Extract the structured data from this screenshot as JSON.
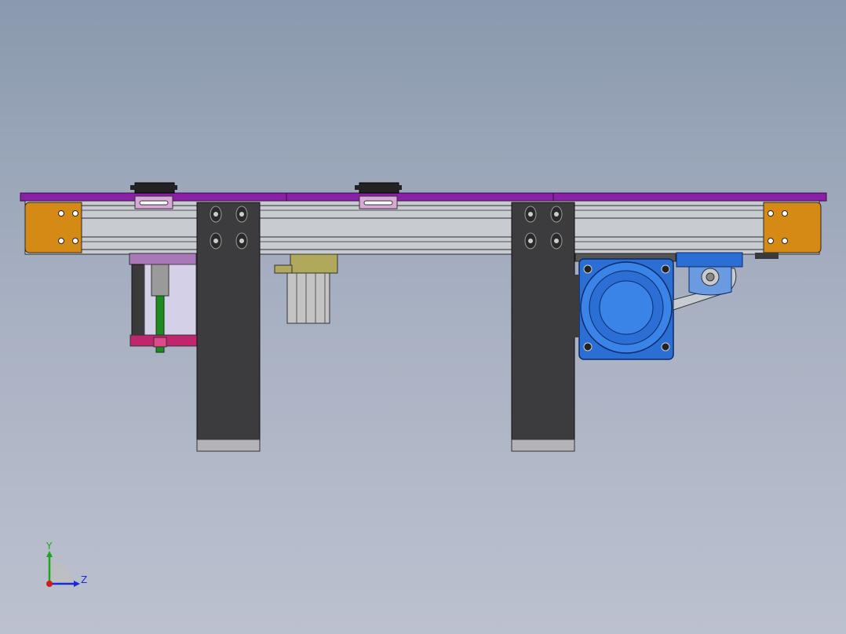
{
  "view": {
    "background_top": "#8a99ae",
    "background_bottom": "#bcc1cf"
  },
  "model": {
    "belt_color": "#8c1fa8",
    "rail_color": "#c8ccd2",
    "end_cap_color": "#d48a14",
    "leg_color": "#3c3c3e",
    "motor_color": "#2b6fd4",
    "cylinder_rod_color": "#1f8a1f",
    "bracket_color": "#c0266e",
    "sensor_color": "#b0a85a"
  },
  "triad": {
    "y_label": "Y",
    "z_label": "Z",
    "y_color": "#1aa81a",
    "z_color": "#1a2ad4",
    "x_color": "#d41a1a"
  }
}
